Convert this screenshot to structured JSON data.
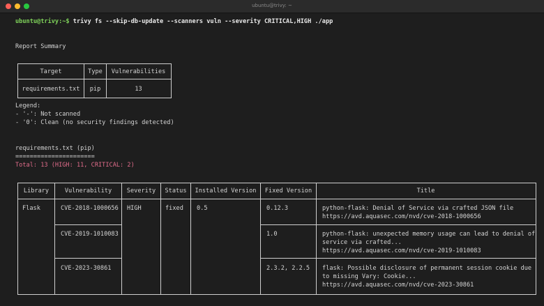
{
  "window": {
    "title": "ubuntu@trivy: ~"
  },
  "command": {
    "prompt": "ubuntu@trivy:~$",
    "text": " trivy fs --skip-db-update --scanners vuln --severity CRITICAL,HIGH ./app"
  },
  "report": {
    "heading": "Report Summary",
    "headers": [
      "Target",
      "Type",
      "Vulnerabilities"
    ],
    "row": [
      "requirements.txt",
      "pip",
      "13"
    ]
  },
  "legend": {
    "title": "Legend:",
    "items": [
      "- '-': Not scanned",
      "- '0': Clean (no security findings detected)"
    ]
  },
  "section": {
    "title": "requirements.txt (pip)",
    "underline": "======================",
    "total": "Total: 13 (HIGH: 11, CRITICAL: 2)"
  },
  "vuln_table": {
    "headers": [
      "Library",
      "Vulnerability",
      "Severity",
      "Status",
      "Installed Version",
      "Fixed Version",
      "Title"
    ],
    "library": "Flask",
    "severity": "HIGH",
    "status": "fixed",
    "installed": "0.5",
    "rows": [
      {
        "id": "CVE-2018-1000656",
        "fixed": "0.12.3",
        "title1": "python-flask: Denial of Service via crafted JSON file",
        "title2": "https://avd.aquasec.com/nvd/cve-2018-1000656"
      },
      {
        "id": "CVE-2019-1010083",
        "fixed": "1.0",
        "title1": "python-flask: unexpected memory usage can lead to denial of",
        "title2": "service via crafted...",
        "title3": "https://avd.aquasec.com/nvd/cve-2019-1010083"
      },
      {
        "id": "CVE-2023-30861",
        "fixed": "2.3.2, 2.2.5",
        "title1": "flask: Possible disclosure of permanent session cookie due",
        "title2": "to missing Vary: Cookie...",
        "title3": "https://avd.aquasec.com/nvd/cve-2023-30861"
      }
    ]
  }
}
